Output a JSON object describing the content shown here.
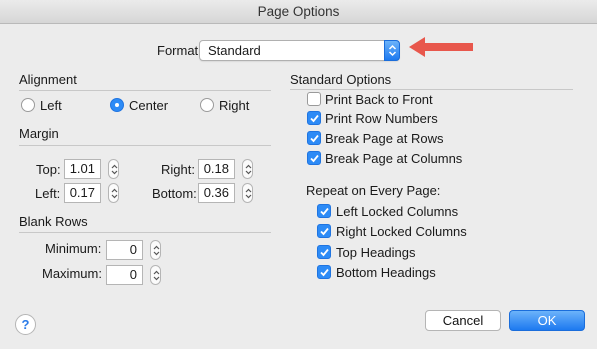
{
  "window": {
    "title": "Page Options"
  },
  "format": {
    "label": "Format:",
    "value": "Standard"
  },
  "alignment": {
    "title": "Alignment",
    "options": [
      {
        "label": "Left",
        "selected": false
      },
      {
        "label": "Center",
        "selected": true
      },
      {
        "label": "Right",
        "selected": false
      }
    ]
  },
  "margin": {
    "title": "Margin",
    "top": {
      "label": "Top:",
      "value": "1.01"
    },
    "left": {
      "label": "Left:",
      "value": "0.17"
    },
    "right": {
      "label": "Right:",
      "value": "0.18"
    },
    "bottom": {
      "label": "Bottom:",
      "value": "0.36"
    }
  },
  "blank_rows": {
    "title": "Blank Rows",
    "minimum": {
      "label": "Minimum:",
      "value": "0"
    },
    "maximum": {
      "label": "Maximum:",
      "value": "0"
    }
  },
  "standard_options": {
    "title": "Standard Options",
    "items": [
      {
        "label": "Print Back to Front",
        "checked": false
      },
      {
        "label": "Print Row Numbers",
        "checked": true
      },
      {
        "label": "Break Page at Rows",
        "checked": true
      },
      {
        "label": "Break Page at Columns",
        "checked": true
      }
    ]
  },
  "repeat": {
    "title": "Repeat on Every Page:",
    "items": [
      {
        "label": "Left Locked Columns",
        "checked": true
      },
      {
        "label": "Right Locked Columns",
        "checked": true
      },
      {
        "label": "Top Headings",
        "checked": true
      },
      {
        "label": "Bottom Headings",
        "checked": true
      }
    ]
  },
  "buttons": {
    "cancel": "Cancel",
    "ok": "OK",
    "help": "?"
  },
  "colors": {
    "accent": "#2d8bf6",
    "annotation_arrow": "#e8574c"
  },
  "icons": {
    "popup": "chevron-updown-icon",
    "checkmark": "checkmark-icon",
    "annotation": "red-arrow-icon"
  }
}
